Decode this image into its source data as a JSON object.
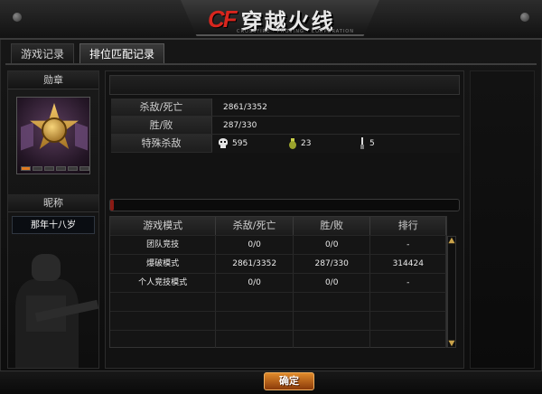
{
  "header": {
    "logo_cf": "CF",
    "title": "穿越火线",
    "subtitle": "CROSSFIRE · PROVING · CORPORATION"
  },
  "tabs": [
    {
      "label": "游戏记录",
      "active": false
    },
    {
      "label": "排位匹配记录",
      "active": true
    }
  ],
  "sidebar": {
    "badge_title": "勋章",
    "badge_pips": [
      true,
      false,
      false,
      false,
      false,
      false
    ],
    "nickname_title": "昵称",
    "nickname": "那年十八岁"
  },
  "stats": {
    "kills_deaths_label": "杀敌/死亡",
    "kills_deaths_value": "2861/3352",
    "win_loss_label": "胜/败",
    "win_loss_value": "287/330",
    "special_kills_label": "特殊杀敌",
    "special_kills": [
      {
        "icon": "skull-icon",
        "value": "595"
      },
      {
        "icon": "grenade-icon",
        "value": "23"
      },
      {
        "icon": "knife-icon",
        "value": "5"
      }
    ]
  },
  "progress": {
    "fraction": 0.01,
    "color": "#8a1a14"
  },
  "mode_table": {
    "headers": [
      "游戏模式",
      "杀敌/死亡",
      "胜/败",
      "排行"
    ],
    "rows": [
      {
        "mode": "团队竞技",
        "kd": "0/0",
        "wl": "0/0",
        "rank": "-"
      },
      {
        "mode": "爆破模式",
        "kd": "2861/3352",
        "wl": "287/330",
        "rank": "314424"
      },
      {
        "mode": "个人竞技模式",
        "kd": "0/0",
        "wl": "0/0",
        "rank": "-"
      }
    ]
  },
  "confirm_button": {
    "label": "确定"
  },
  "colors": {
    "accent": "#d8261e",
    "button": "#e08a2a",
    "frame": "#2c2c2c"
  }
}
